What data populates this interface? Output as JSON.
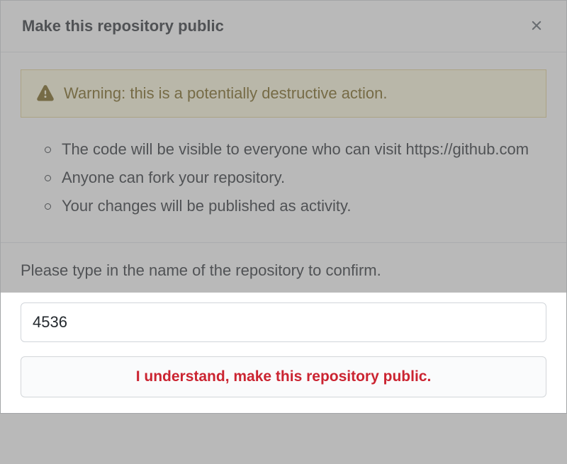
{
  "dialog": {
    "title": "Make this repository public"
  },
  "warning": {
    "text": "Warning: this is a potentially destructive action."
  },
  "consequences": {
    "items": [
      "The code will be visible to everyone who can visit https://github.com",
      "Anyone can fork your repository.",
      "Your changes will be published as activity."
    ]
  },
  "confirm": {
    "prompt": "Please type in the name of the repository to confirm.",
    "input_value": "4536",
    "button_label": "I understand, make this repository public."
  }
}
